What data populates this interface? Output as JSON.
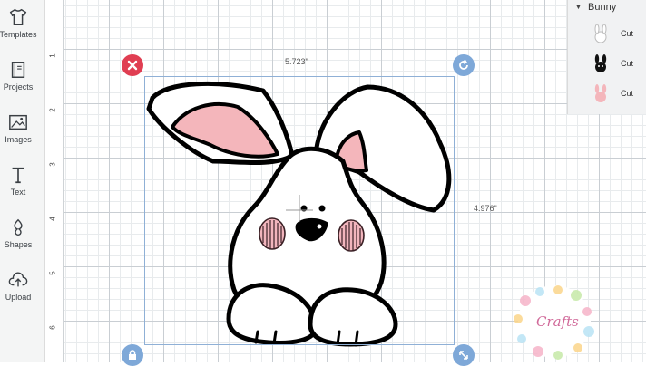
{
  "toolbar": {
    "items": [
      {
        "label": "Templates",
        "icon": "shirt-icon"
      },
      {
        "label": "Projects",
        "icon": "notebook-icon"
      },
      {
        "label": "Images",
        "icon": "image-icon"
      },
      {
        "label": "Text",
        "icon": "text-icon"
      },
      {
        "label": "Shapes",
        "icon": "shapes-icon"
      },
      {
        "label": "Upload",
        "icon": "upload-icon"
      }
    ]
  },
  "ruler": {
    "vertical_ticks": [
      "1",
      "2",
      "3",
      "4",
      "5",
      "6"
    ]
  },
  "selection": {
    "width_label": "5.723\"",
    "height_label": "4.976\""
  },
  "layers": {
    "group_name": "Bunny",
    "items": [
      {
        "operation": "Cut",
        "thumb": "bunny-outline"
      },
      {
        "operation": "Cut",
        "thumb": "bunny-black"
      },
      {
        "operation": "Cut",
        "thumb": "bunny-pink"
      }
    ]
  },
  "colors": {
    "delete": "#e03e52",
    "handle_blue": "#7ea8d8",
    "ear_pink": "#f4b6bb",
    "selection": "#8fb0d6"
  },
  "watermark": {
    "text": "Crafts"
  }
}
